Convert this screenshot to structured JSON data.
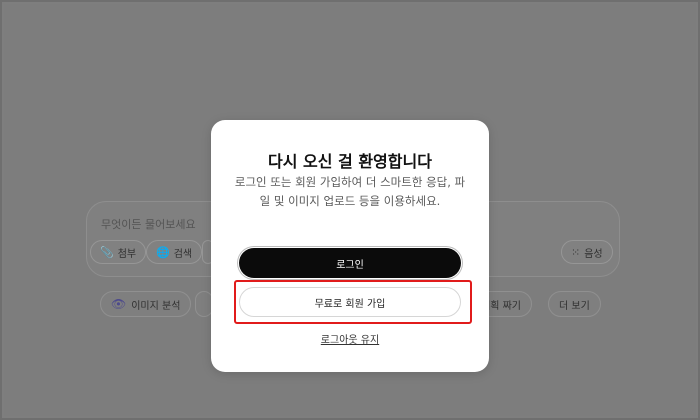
{
  "composer": {
    "placeholder": "무엇이든 물어보세요",
    "attach_label": "첨부",
    "search_label": "검색",
    "voice_label": "음성"
  },
  "quick_actions": {
    "image_analysis": "이미지 분석",
    "plan": "계획 짜기",
    "more": "더 보기"
  },
  "modal": {
    "title": "다시 오신 걸 환영합니다",
    "description": "로그인 또는 회원 가입하여 더 스마트한 응답, 파일 및 이미지 업로드 등을 이용하세요.",
    "login_label": "로그인",
    "signup_label": "무료로 회원 가입",
    "logout_link": "로그아웃 유지"
  },
  "colors": {
    "overlay": "#7e7e7e",
    "primary_button": "#0b0b0b",
    "highlight": "#e11b1b"
  }
}
